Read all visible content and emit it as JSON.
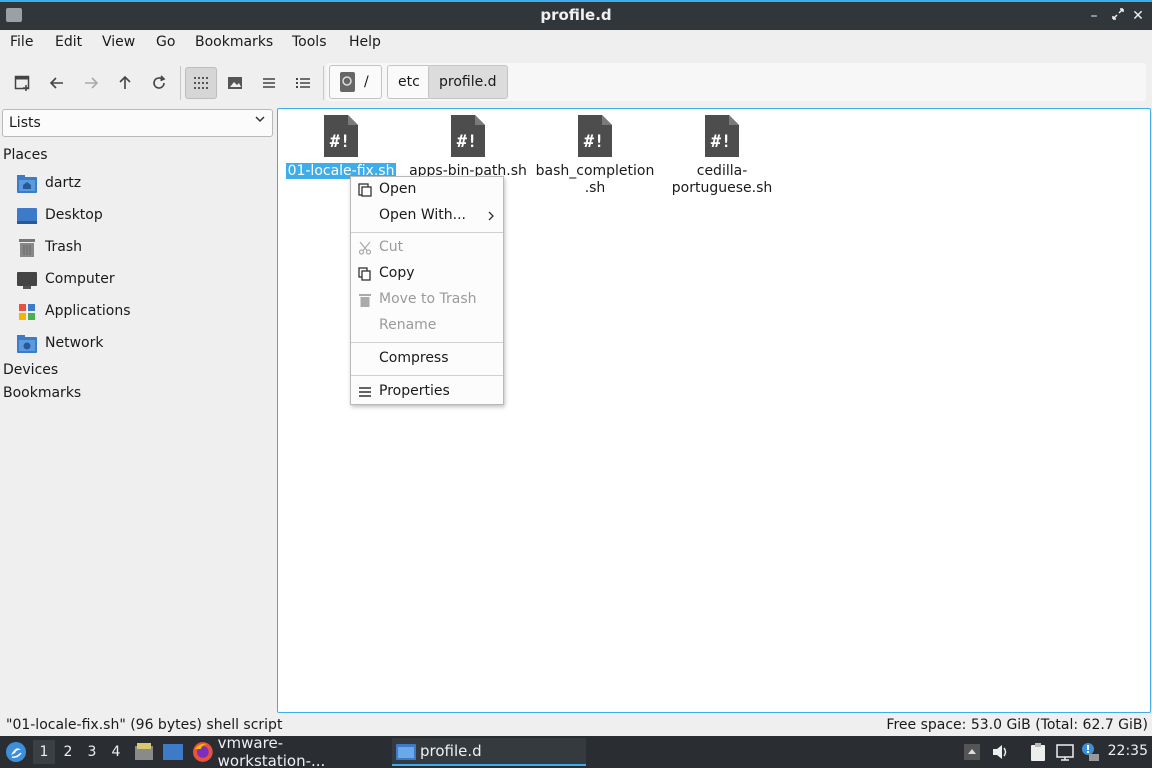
{
  "window": {
    "title": "profile.d"
  },
  "menu": [
    "File",
    "Edit",
    "View",
    "Go",
    "Bookmarks",
    "Tools",
    "Help"
  ],
  "breadcrumbs": [
    "/",
    "etc",
    "profile.d"
  ],
  "sidebar": {
    "select_value": "Lists",
    "places_heading": "Places",
    "places": [
      "dartz",
      "Desktop",
      "Trash",
      "Computer",
      "Applications",
      "Network"
    ],
    "devices_heading": "Devices",
    "bookmarks_heading": "Bookmarks"
  },
  "files": [
    {
      "name": "01-locale-fix.sh",
      "selected": true
    },
    {
      "name": "apps-bin-path.sh"
    },
    {
      "name_line1": "bash_completion",
      "name_line2": ".sh"
    },
    {
      "name_line1": "cedilla-",
      "name_line2": "portuguese.sh"
    }
  ],
  "context_menu": {
    "open": "Open",
    "open_with": "Open With...",
    "cut": "Cut",
    "copy": "Copy",
    "move_to_trash": "Move to Trash",
    "rename": "Rename",
    "compress": "Compress",
    "properties": "Properties"
  },
  "status": {
    "left": "\"01-locale-fix.sh\" (96 bytes) shell script",
    "right": "Free space: 53.0 GiB (Total: 62.7 GiB)"
  },
  "taskbar": {
    "desktops": [
      "1",
      "2",
      "3",
      "4"
    ],
    "tasks": [
      "vmware-workstation-...",
      "profile.d"
    ],
    "clock": "22:35"
  },
  "colors": {
    "accent": "#3daee9",
    "titlebar": "#31363b",
    "taskbar": "#2a2e32"
  }
}
